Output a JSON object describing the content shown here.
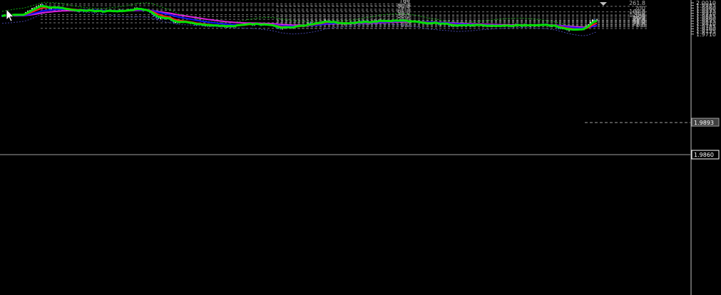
{
  "colors": {
    "background": "#000000",
    "up_candle": "#e6e6e6",
    "down_candle": "#3c8cff",
    "ma_fast": "#00e000",
    "ma_mid": "#ff2020",
    "ma_slow": "#1010ff",
    "ma_long": "#e020e0",
    "bands_green": "#11aa11",
    "bands_blue": "#4444aa",
    "fib_line": "#7a7a7a",
    "axis": "#c0c0c0"
  },
  "icons": {
    "cursor": "mouse-pointer-icon",
    "scroll_marker": "triangle-down-icon"
  },
  "price_axis": {
    "labels": [
      "2.0010",
      "1.9985",
      "1.9960",
      "1.9935",
      "1.9910",
      "1.9885",
      "1.9860",
      "1.9835",
      "1.9810",
      "1.9785",
      "1.9760",
      "1.9735",
      "1.9710"
    ],
    "label_values": [
      2.001,
      1.9985,
      1.996,
      1.9935,
      1.991,
      1.9885,
      1.986,
      1.9835,
      1.981,
      1.9785,
      1.976,
      1.9735,
      1.971
    ],
    "current_price": "1.9860",
    "current_price_value": 1.986,
    "crosshair_price": "1.9893",
    "crosshair_price_value": 1.9893
  },
  "fib_set_1": {
    "levels": [
      {
        "label": "100",
        "price": 1.99995
      },
      {
        "label": "95",
        "price": 1.99825
      },
      {
        "label": "80.9",
        "price": 1.99495
      },
      {
        "label": "76.4",
        "price": 1.99365
      },
      {
        "label": "61.8",
        "price": 1.98965
      },
      {
        "label": "50.0",
        "price": 1.98785
      },
      {
        "label": "38.2",
        "price": 1.98515
      },
      {
        "label": "23.6",
        "price": 1.98185
      },
      {
        "label": "0.0",
        "price": 1.97655
      }
    ]
  },
  "fib_set_2": {
    "levels": [
      {
        "label": "261.8",
        "price": 1.99765
      },
      {
        "label": "200",
        "price": 1.99235
      },
      {
        "label": "161.8",
        "price": 1.98935
      },
      {
        "label": "150",
        "price": 1.98815
      },
      {
        "label": "123.6",
        "price": 1.98635
      },
      {
        "label": "100",
        "price": 1.98455
      },
      {
        "label": "95",
        "price": 1.98395
      },
      {
        "label": "80.9",
        "price": 1.98305
      },
      {
        "label": "76.4",
        "price": 1.98225
      },
      {
        "label": "61.8",
        "price": 1.98085
      },
      {
        "label": "50.0",
        "price": 1.97995
      },
      {
        "label": "38.2",
        "price": 1.97905
      },
      {
        "label": "23.6",
        "price": 1.97795
      },
      {
        "label": "0.0",
        "price": 1.97635
      }
    ]
  }
}
